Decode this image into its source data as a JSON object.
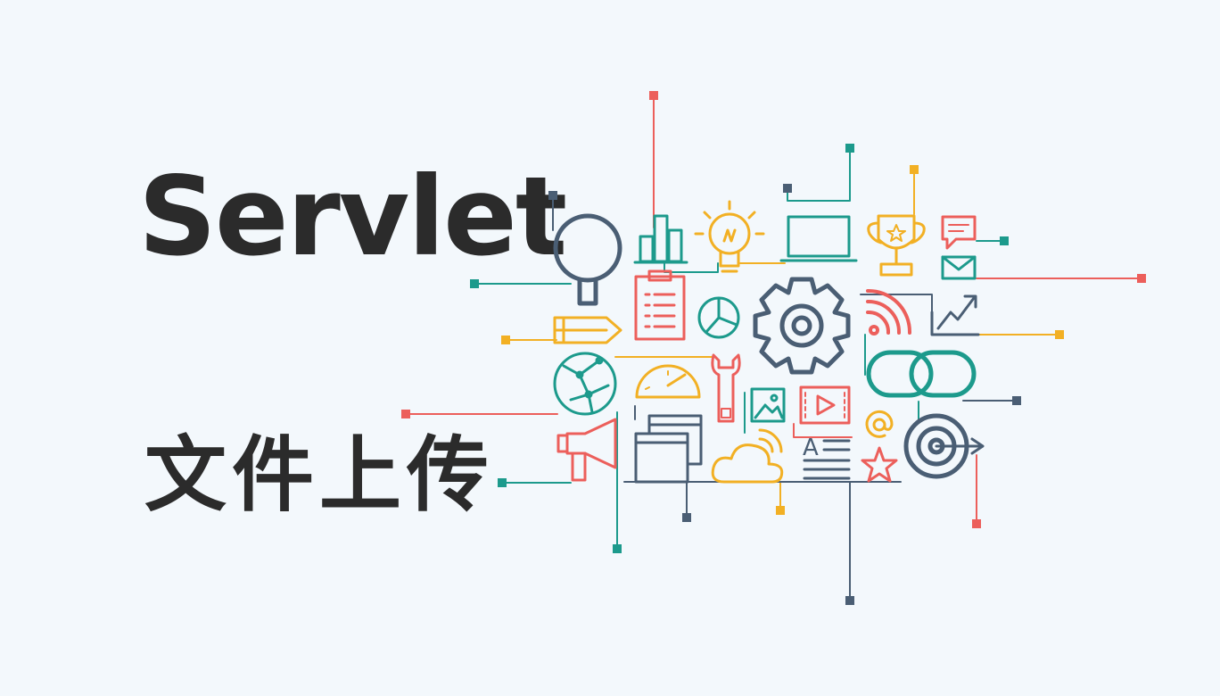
{
  "heading": {
    "title": "Servlet",
    "subtitle": "文件上传"
  },
  "colors": {
    "background": "#f3f8fc",
    "text": "#2b2b2b",
    "navy": "#4a5e74",
    "teal": "#1c9a8c",
    "orange": "#f2b024",
    "red": "#ec5f5b"
  },
  "illustration": {
    "icons": [
      "magnifier-icon",
      "bar-chart-icon",
      "lightbulb-icon",
      "laptop-icon",
      "trophy-icon",
      "chat-bubble-icon",
      "envelope-icon",
      "clipboard-icon",
      "pie-chart-icon",
      "gear-icon",
      "rss-icon",
      "growth-chart-icon",
      "pencil-icon",
      "globe-network-icon",
      "speedometer-icon",
      "wrench-icon",
      "chain-link-icon",
      "image-icon",
      "video-icon",
      "megaphone-icon",
      "windows-icon",
      "cloud-wifi-icon",
      "text-document-icon",
      "at-sign-icon",
      "star-icon",
      "target-icon"
    ],
    "text_document_letter": "A"
  }
}
